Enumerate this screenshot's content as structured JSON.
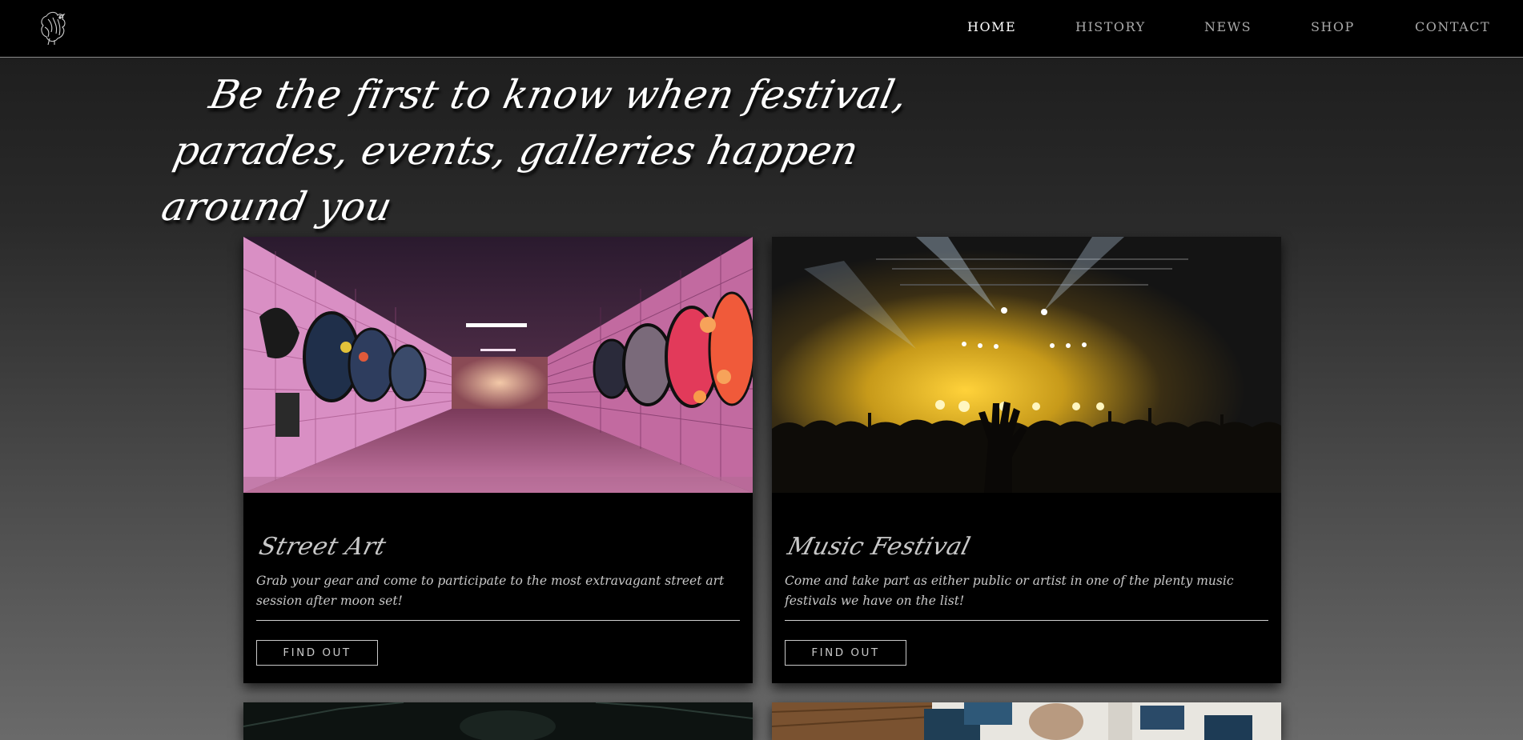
{
  "header": {
    "nav": [
      {
        "label": "HOME",
        "active": true
      },
      {
        "label": "HISTORY",
        "active": false
      },
      {
        "label": "NEWS",
        "active": false
      },
      {
        "label": "SHOP",
        "active": false
      },
      {
        "label": "CONTACT",
        "active": false
      }
    ],
    "logo_icon": "rooster-illustration-icon"
  },
  "hero": {
    "line1": "Be the first to know when festival,",
    "line2": "parades, events, galleries happen around you"
  },
  "cards": [
    {
      "title": "Street Art",
      "description": "Grab your gear and come to participate to the most extravagant street art session after moon set!",
      "button": "FIND OUT",
      "image": "graffiti-tunnel-photo"
    },
    {
      "title": "Music Festival",
      "description": "Come and take part as either public or artist in one of the plenty music festivals we have on the list!",
      "button": "FIND OUT",
      "image": "concert-crowd-photo"
    }
  ],
  "colors": {
    "topbar": "#000000",
    "active_nav": "#ffffff",
    "nav": "#a9a9a9",
    "card_bg": "#000000"
  }
}
